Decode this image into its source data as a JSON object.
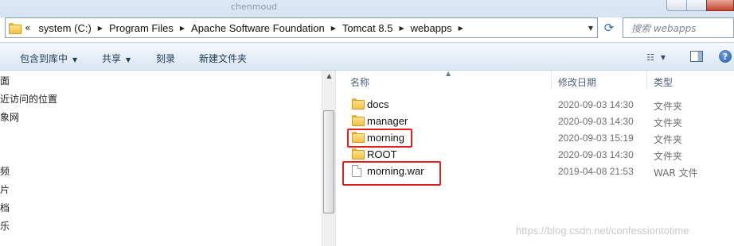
{
  "window": {
    "ghost_tab_text": "chenmoud"
  },
  "address_bar": {
    "overflow": "«",
    "crumbs": [
      "system (C:)",
      "Program Files",
      "Apache Software Foundation",
      "Tomcat 8.5",
      "webapps"
    ]
  },
  "search": {
    "placeholder": "搜索 webapps"
  },
  "toolbar": {
    "include_in_library": "包含到库中",
    "share": "共享",
    "burn": "刻录",
    "new_folder": "新建文件夹"
  },
  "nav": {
    "items": [
      "面",
      "近访问的位置",
      "象网",
      "频",
      "片",
      "档",
      "乐"
    ]
  },
  "columns": {
    "name": "名称",
    "modified": "修改日期",
    "type": "类型"
  },
  "files": [
    {
      "name": "docs",
      "date": "2020-09-03 14:30",
      "type": "文件夹",
      "icon": "folder-icon"
    },
    {
      "name": "manager",
      "date": "2020-09-03 14:30",
      "type": "文件夹",
      "icon": "folder-icon"
    },
    {
      "name": "morning",
      "date": "2020-09-03 15:19",
      "type": "文件夹",
      "icon": "folder-icon"
    },
    {
      "name": "ROOT",
      "date": "2020-09-03 14:30",
      "type": "文件夹",
      "icon": "folder-icon"
    },
    {
      "name": "morning.war",
      "date": "2019-04-08 21:53",
      "type": "WAR 文件",
      "icon": "file-icon"
    }
  ],
  "highlight_color": "#e02020",
  "watermark": "https://blog.csdn.net/confessiontotime"
}
